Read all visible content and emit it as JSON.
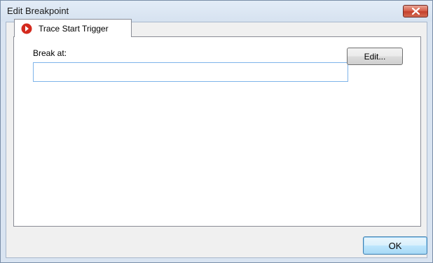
{
  "window": {
    "title": "Edit Breakpoint",
    "close_icon": "close-icon"
  },
  "tabs": [
    {
      "label": "Trace Start Trigger",
      "icon": "trace-trigger-icon",
      "selected": true
    }
  ],
  "form": {
    "break_at_label": "Break at:",
    "break_at_value": "",
    "break_at_placeholder": "",
    "edit_button_label": "Edit..."
  },
  "footer": {
    "ok_button_label": "OK"
  },
  "colors": {
    "titlebar": "#d9e4f1",
    "close_button": "#c5402c",
    "trace_icon": "#d42a1e",
    "input_border": "#7eb4ea",
    "ok_border": "#3c7fb1"
  }
}
